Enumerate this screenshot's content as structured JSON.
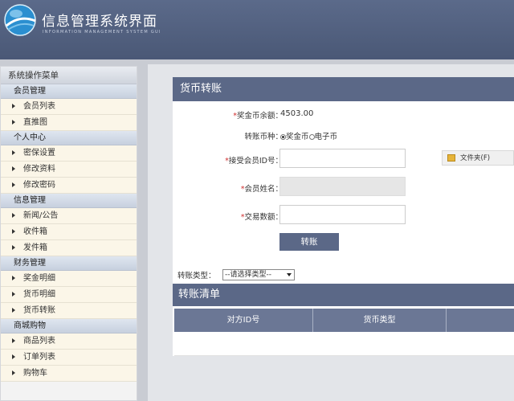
{
  "header": {
    "title": "信息管理系统界面",
    "subtitle": "INFORMATION MANAGEMENT SYSTEM GUI"
  },
  "sidebar": {
    "title": "系统操作菜单",
    "groups": [
      {
        "label": "会员管理",
        "items": [
          {
            "label": "会员列表"
          },
          {
            "label": "直推图"
          }
        ]
      },
      {
        "label": "个人中心",
        "items": [
          {
            "label": "密保设置"
          },
          {
            "label": "修改资料"
          },
          {
            "label": "修改密码"
          }
        ]
      },
      {
        "label": "信息管理",
        "items": [
          {
            "label": "新闻/公告"
          },
          {
            "label": "收件箱"
          },
          {
            "label": "发件箱"
          }
        ]
      },
      {
        "label": "财务管理",
        "items": [
          {
            "label": "奖金明细"
          },
          {
            "label": "货币明细"
          },
          {
            "label": "货币转账"
          }
        ]
      },
      {
        "label": "商城购物",
        "items": [
          {
            "label": "商品列表"
          },
          {
            "label": "订单列表"
          },
          {
            "label": "购物车"
          }
        ]
      }
    ]
  },
  "transfer": {
    "title": "货币转账",
    "balance_label": "奖金币余额：",
    "balance_value": "4503.00",
    "currency_label": "转账币种：",
    "currency_options": [
      "奖金币",
      "电子币"
    ],
    "receiver_label": "接受会员ID号：",
    "receiver_value": "",
    "name_label": "会员姓名：",
    "amount_label": "交易数额：",
    "amount_value": "",
    "submit_label": "转账",
    "required_mark": "*"
  },
  "folder_button": {
    "label": "文件夹(F)"
  },
  "filter": {
    "label": "转账类型：",
    "selected": "--请选择类型--"
  },
  "list": {
    "title": "转账清单",
    "columns": [
      "对方ID号",
      "货币类型",
      ""
    ]
  }
}
